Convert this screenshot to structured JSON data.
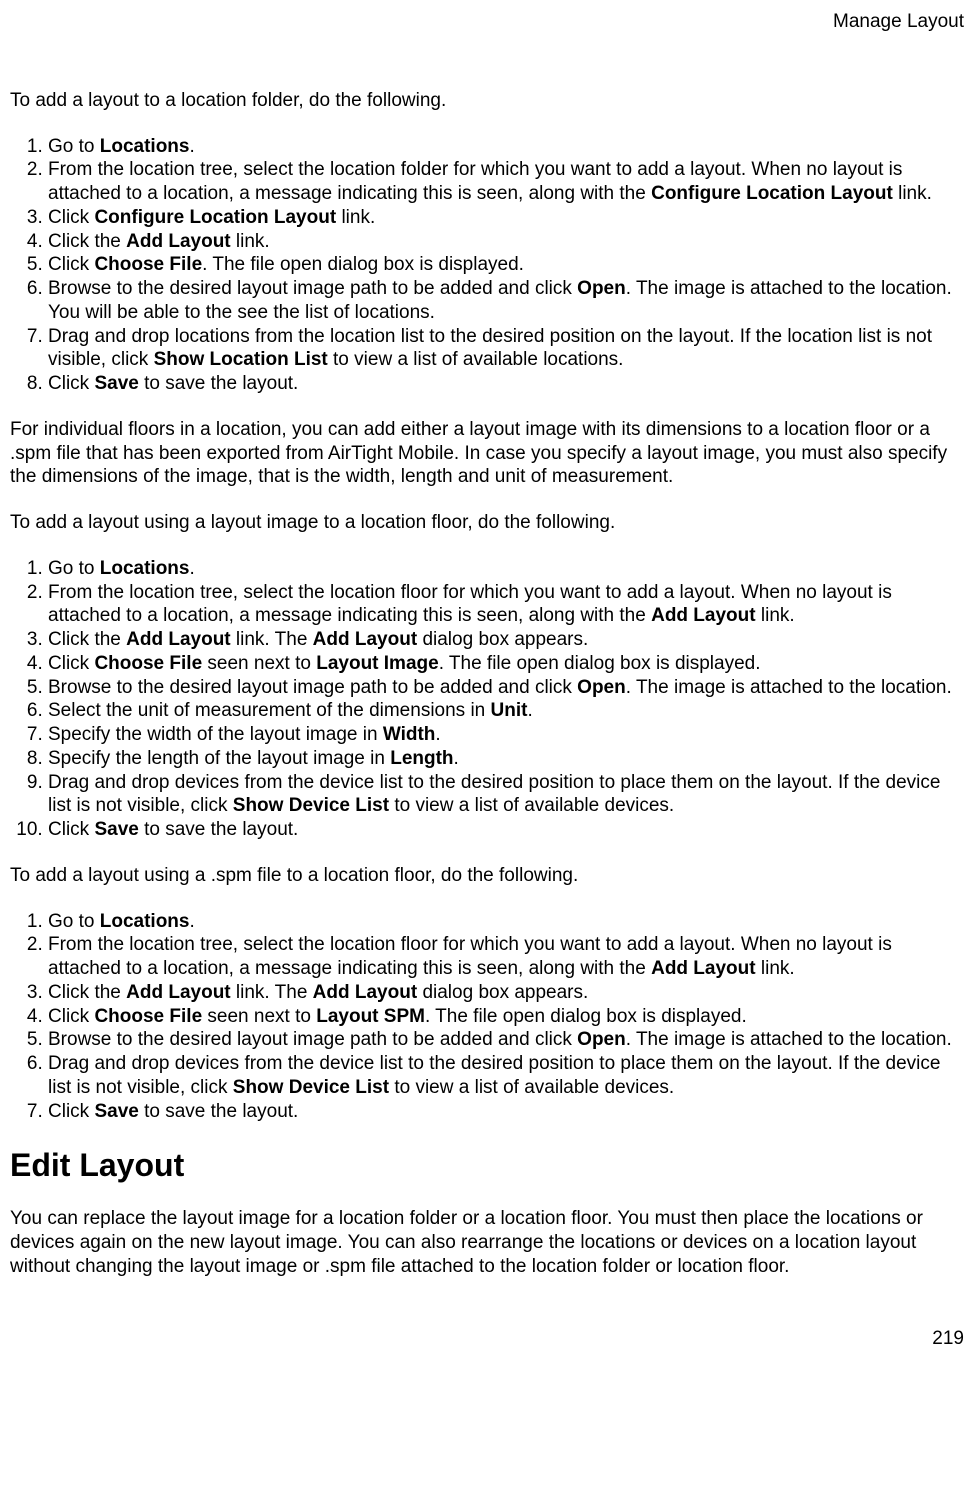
{
  "header": {
    "title": "Manage Layout"
  },
  "intro1": "To add a layout to a location folder, do the following.",
  "list1": {
    "i1a": "Go to ",
    "i1b": "Locations",
    "i1c": ".",
    "i2a": "From the location tree, select the location folder for which you want to add a layout. When no layout is attached to a location, a message indicating this is seen, along with the ",
    "i2b": "Configure Location Layout",
    "i2c": " link.",
    "i3a": "Click ",
    "i3b": "Configure Location Layout",
    "i3c": " link.",
    "i4a": "Click the ",
    "i4b": "Add Layout",
    "i4c": " link.",
    "i5a": "Click ",
    "i5b": "Choose File",
    "i5c": ". The file open dialog box is displayed.",
    "i6a": "Browse to the desired layout image path to be added and click ",
    "i6b": "Open",
    "i6c": ". The image is attached to the location. You will be able to the see the list of locations.",
    "i7a": "Drag and drop locations from the location list to the desired position on the layout. If the location list is not visible, click ",
    "i7b": "Show Location List",
    "i7c": " to view a list of available locations.",
    "i8a": "Click ",
    "i8b": "Save",
    "i8c": " to save the layout."
  },
  "para1": "For individual floors in a location, you can add either a layout image with its dimensions to a location floor or a .spm file that has been exported from AirTight Mobile. In case you specify a layout image, you must also specify the dimensions of the image, that is the width, length and unit of measurement.",
  "intro2": "To add a layout using a layout image to a location floor, do the following.",
  "list2": {
    "i1a": "Go to ",
    "i1b": "Locations",
    "i1c": ".",
    "i2a": "From the location tree, select the location floor for which you want to add a layout. When no layout is attached to a location, a message indicating this is seen, along with the ",
    "i2b": "Add Layout",
    "i2c": " link.",
    "i3a": "Click the ",
    "i3b": "Add Layout",
    "i3c": " link. The ",
    "i3d": "Add Layout",
    "i3e": " dialog box appears.",
    "i4a": "Click ",
    "i4b": "Choose File",
    "i4c": " seen next to ",
    "i4d": "Layout Image",
    "i4e": ". The file open dialog box is displayed.",
    "i5a": "Browse to the desired layout image path to be added and click ",
    "i5b": "Open",
    "i5c": ". The image is attached to the location.",
    "i6a": "Select the unit of measurement of the dimensions in ",
    "i6b": "Unit",
    "i6c": ".",
    "i7a": "Specify the width of the layout image in ",
    "i7b": "Width",
    "i7c": ".",
    "i8a": "Specify the length of the layout image in ",
    "i8b": "Length",
    "i8c": ".",
    "i9a": "Drag and drop devices from the device list to the desired position to place them on the layout. If the device list is not visible, click ",
    "i9b": "Show Device List",
    "i9c": " to view a list of available devices.",
    "i10a": "Click ",
    "i10b": "Save",
    "i10c": " to save the layout."
  },
  "intro3": "To add a layout using a .spm file to a location floor, do the following.",
  "list3": {
    "i1a": "Go to ",
    "i1b": "Locations",
    "i1c": ".",
    "i2a": "From the location tree, select the location floor for which you want to add a layout. When no layout is attached to a location, a message indicating this is seen, along with the ",
    "i2b": "Add Layout",
    "i2c": " link.",
    "i3a": "Click the ",
    "i3b": "Add Layout",
    "i3c": " link. The ",
    "i3d": "Add Layout",
    "i3e": " dialog box appears.",
    "i4a": "Click ",
    "i4b": "Choose File",
    "i4c": " seen next to ",
    "i4d": "Layout SPM",
    "i4e": ". The file open dialog box is displayed.",
    "i5a": "Browse to the desired layout image path to be added and click ",
    "i5b": "Open",
    "i5c": ". The image is attached to the location.",
    "i6a": "Drag and drop devices from the device list to the desired position to place them on the layout. If the device list is not visible, click ",
    "i6b": "Show Device List",
    "i6c": " to view a list of available devices.",
    "i7a": "Click ",
    "i7b": "Save",
    "i7c": " to save the layout."
  },
  "heading2": "Edit Layout",
  "para2": "You can replace the layout image for a location folder or a location floor. You must then place the locations or devices again on the new layout image. You can also rearrange the locations or devices on a location layout without changing the layout image or .spm file attached to the location folder or location floor.",
  "footer": {
    "page": "219"
  }
}
